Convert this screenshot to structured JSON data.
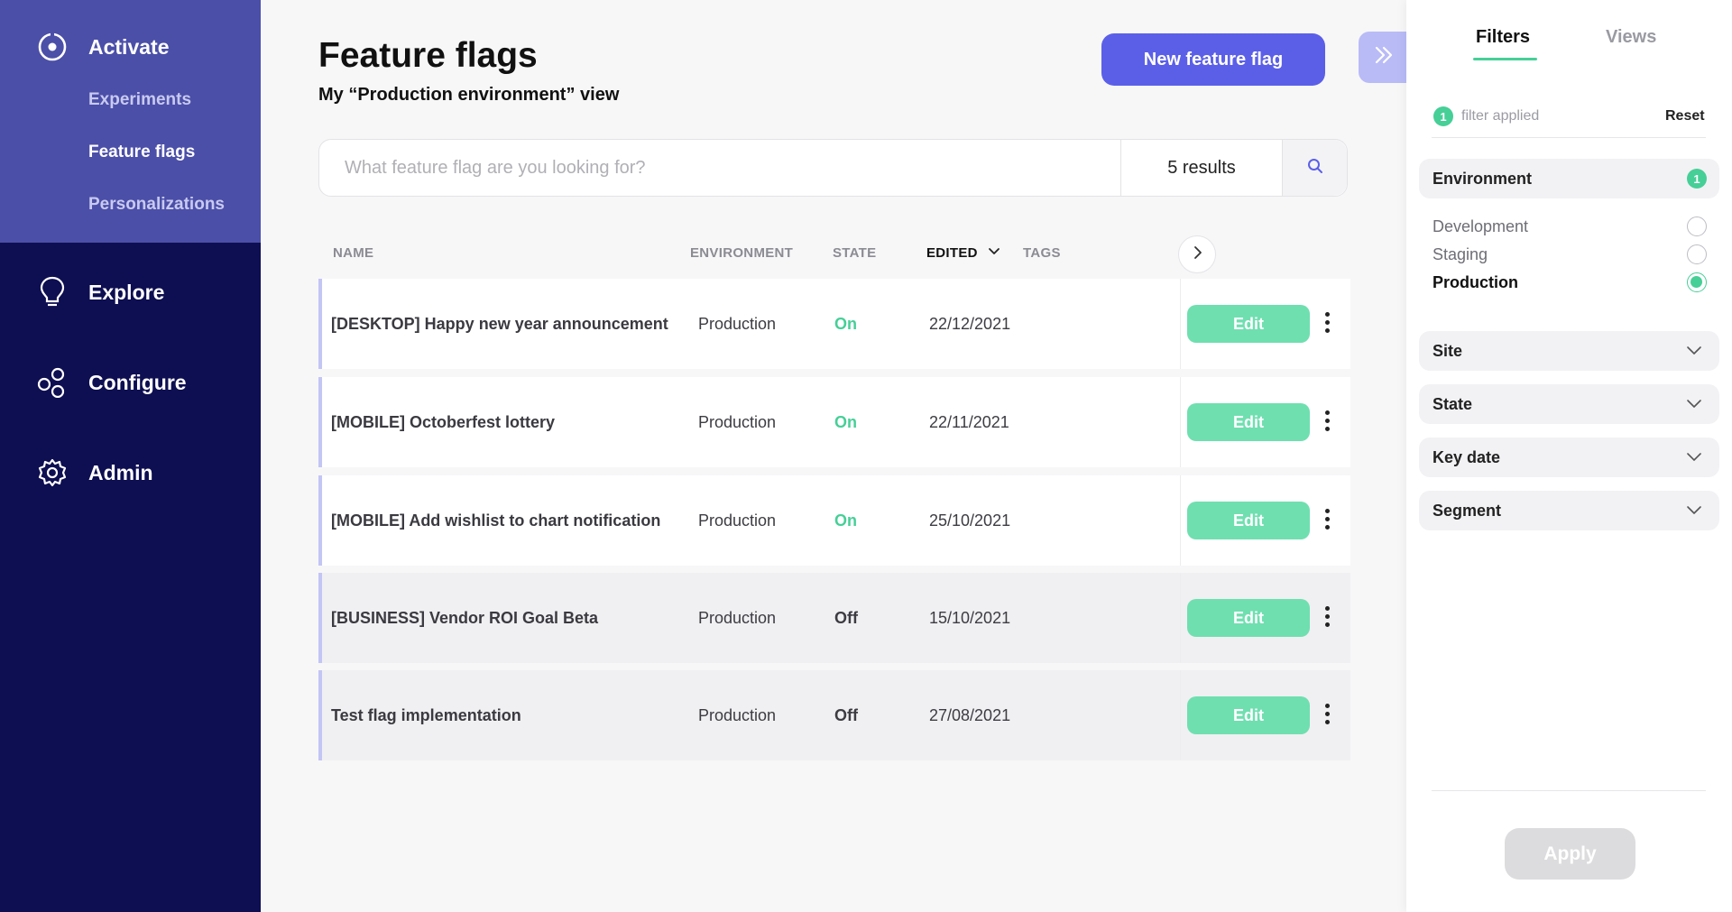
{
  "sidebar": {
    "activate": {
      "label": "Activate",
      "icon": "target-icon"
    },
    "sub_items": [
      {
        "label": "Experiments",
        "active": false
      },
      {
        "label": "Feature flags",
        "active": true
      },
      {
        "label": "Personalizations",
        "active": false
      }
    ],
    "explore": {
      "label": "Explore",
      "icon": "lightbulb-icon"
    },
    "configure": {
      "label": "Configure",
      "icon": "nodes-icon"
    },
    "admin": {
      "label": "Admin",
      "icon": "gear-icon"
    }
  },
  "header": {
    "title": "Feature flags",
    "subtitle": "My “Production environment” view",
    "new_button": "New feature flag"
  },
  "search": {
    "placeholder": "What feature flag are you looking for?",
    "value": "",
    "results": "5 results"
  },
  "table": {
    "columns": {
      "name": "NAME",
      "environment": "ENVIRONMENT",
      "state": "STATE",
      "edited": "EDITED",
      "tags": "TAGS"
    },
    "rows": [
      {
        "name": "[DESKTOP] Happy new year announcement",
        "environment": "Production",
        "state": "On",
        "edited": "22/12/2021",
        "action": "Edit"
      },
      {
        "name": "[MOBILE] Octoberfest lottery",
        "environment": "Production",
        "state": "On",
        "edited": "22/11/2021",
        "action": "Edit"
      },
      {
        "name": "[MOBILE] Add wishlist to chart notification",
        "environment": "Production",
        "state": "On",
        "edited": "25/10/2021",
        "action": "Edit"
      },
      {
        "name": "[BUSINESS] Vendor ROI Goal Beta",
        "environment": "Production",
        "state": "Off",
        "edited": "15/10/2021",
        "action": "Edit"
      },
      {
        "name": "Test flag implementation",
        "environment": "Production",
        "state": "Off",
        "edited": "27/08/2021",
        "action": "Edit"
      }
    ]
  },
  "filters_panel": {
    "tabs": [
      "Filters",
      "Views"
    ],
    "applied_count": "1",
    "applied_label": "filter applied",
    "reset": "Reset",
    "environment": {
      "label": "Environment",
      "count": "1",
      "options": [
        {
          "label": "Development",
          "selected": false
        },
        {
          "label": "Staging",
          "selected": false
        },
        {
          "label": "Production",
          "selected": true
        }
      ]
    },
    "groups": [
      "Site",
      "State",
      "Key date",
      "Segment"
    ],
    "apply": "Apply"
  },
  "colors": {
    "sidebar_bg": "#0e0e52",
    "activate_bg": "#4b4fa8",
    "primary": "#5b5fe8",
    "success": "#46cf97",
    "edit_button": "#6fdfb0"
  }
}
